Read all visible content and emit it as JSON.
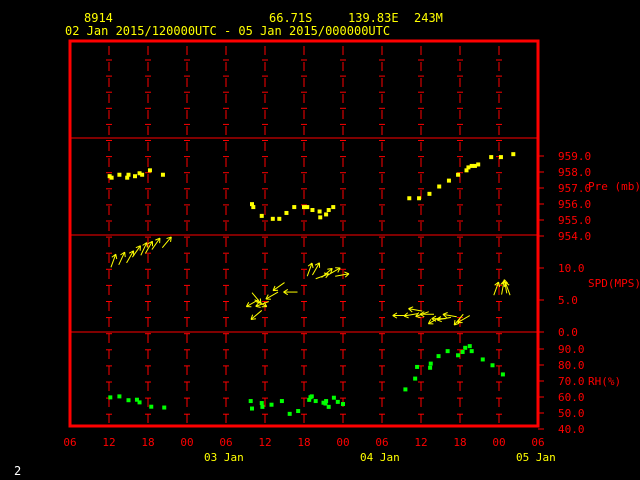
{
  "header": {
    "station_id": "8914",
    "latitude": "66.71S",
    "longitude": "139.83E",
    "elevation": "243M",
    "time_range": "02 Jan 2015/120000UTC - 05 Jan 2015/000000UTC"
  },
  "page_number": "2",
  "colors": {
    "frame": "#ff0000",
    "header_text": "#ffff00",
    "axis_text": "#ff0000",
    "time_text": "#ffff00",
    "pressure_series": "#ffff00",
    "wind_series": "#ffff00",
    "rh_series": "#00ff00"
  },
  "chart_data": {
    "type": "scatter",
    "x_axis": {
      "unit": "hours since 02 Jan 2015 00 UTC",
      "range": [
        6,
        78
      ],
      "tick_labels": [
        "06",
        "12",
        "18",
        "00",
        "06",
        "12",
        "18",
        "00",
        "06",
        "12",
        "18",
        "00",
        "06"
      ],
      "day_labels": [
        {
          "label": "03 Jan",
          "hour": 30
        },
        {
          "label": "04 Jan",
          "hour": 54
        },
        {
          "label": "05 Jan",
          "hour": 78
        }
      ]
    },
    "panels": [
      {
        "name": "pressure",
        "axis_label": "Pre (mb)",
        "ylim": [
          953.6,
          960.2
        ],
        "ticks": [
          "959.0",
          "958.0",
          "957.0",
          "956.0",
          "955.0",
          "954.0"
        ],
        "marker": "square",
        "points": [
          [
            12.1,
            957.6
          ],
          [
            12.4,
            957.5
          ],
          [
            13.6,
            957.7
          ],
          [
            14.8,
            957.5
          ],
          [
            15.0,
            957.7
          ],
          [
            16.0,
            957.6
          ],
          [
            16.7,
            957.8
          ],
          [
            17.1,
            957.7
          ],
          [
            18.3,
            958.0
          ],
          [
            20.3,
            957.7
          ],
          [
            34.0,
            955.7
          ],
          [
            34.2,
            955.5
          ],
          [
            35.5,
            954.9
          ],
          [
            37.2,
            954.7
          ],
          [
            38.2,
            954.7
          ],
          [
            39.3,
            955.1
          ],
          [
            40.5,
            955.5
          ],
          [
            42.0,
            955.5
          ],
          [
            42.5,
            955.5
          ],
          [
            43.3,
            955.3
          ],
          [
            44.4,
            955.2
          ],
          [
            44.5,
            954.8
          ],
          [
            45.4,
            955.0
          ],
          [
            45.8,
            955.3
          ],
          [
            46.5,
            955.5
          ],
          [
            58.2,
            956.1
          ],
          [
            59.7,
            956.1
          ],
          [
            61.3,
            956.4
          ],
          [
            62.8,
            956.9
          ],
          [
            64.3,
            957.3
          ],
          [
            65.7,
            957.7
          ],
          [
            67.0,
            958.0
          ],
          [
            67.3,
            958.2
          ],
          [
            67.8,
            958.3
          ],
          [
            68.3,
            958.3
          ],
          [
            68.8,
            958.4
          ],
          [
            70.8,
            958.9
          ],
          [
            72.3,
            958.9
          ],
          [
            74.2,
            959.1
          ]
        ]
      },
      {
        "name": "wind",
        "axis_label": "SPD(MPS)",
        "ylim": [
          -0.8,
          14.5
        ],
        "ticks": [
          "10.0",
          "5.0",
          "0.0"
        ],
        "note": "arrows drawn at speed height; direction is the meteorological 'from' direction in degrees",
        "points": [
          {
            "h": 12.3,
            "spd": 9.4,
            "dir": 200
          },
          {
            "h": 13.5,
            "spd": 9.8,
            "dir": 205
          },
          {
            "h": 14.7,
            "spd": 10.1,
            "dir": 210
          },
          {
            "h": 15.6,
            "spd": 11.0,
            "dir": 215
          },
          {
            "h": 16.9,
            "spd": 11.3,
            "dir": 205
          },
          {
            "h": 17.6,
            "spd": 11.6,
            "dir": 210
          },
          {
            "h": 18.6,
            "spd": 12.2,
            "dir": 215
          },
          {
            "h": 20.2,
            "spd": 12.5,
            "dir": 220
          },
          {
            "h": 34.0,
            "spd": 5.4,
            "dir": 320
          },
          {
            "h": 34.4,
            "spd": 4.3,
            "dir": 300
          },
          {
            "h": 35.0,
            "spd": 4.3,
            "dir": 60
          },
          {
            "h": 35.5,
            "spd": 2.6,
            "dir": 50
          },
          {
            "h": 36.6,
            "spd": 4.0,
            "dir": 70
          },
          {
            "h": 38.0,
            "spd": 5.5,
            "dir": 60
          },
          {
            "h": 39.0,
            "spd": 7.0,
            "dir": 55
          },
          {
            "h": 41.0,
            "spd": 5.5,
            "dir": 90
          },
          {
            "h": 42.5,
            "spd": 8.0,
            "dir": 200
          },
          {
            "h": 43.3,
            "spd": 8.2,
            "dir": 210
          },
          {
            "h": 43.8,
            "spd": 7.6,
            "dir": 250
          },
          {
            "h": 44.7,
            "spd": 7.8,
            "dir": 230
          },
          {
            "h": 45.7,
            "spd": 8.2,
            "dir": 240
          },
          {
            "h": 46.8,
            "spd": 8.0,
            "dir": 260
          },
          {
            "h": 57.8,
            "spd": 1.8,
            "dir": 90
          },
          {
            "h": 59.5,
            "spd": 2.1,
            "dir": 80
          },
          {
            "h": 60.2,
            "spd": 2.5,
            "dir": 100
          },
          {
            "h": 61.2,
            "spd": 2.4,
            "dir": 70
          },
          {
            "h": 62.0,
            "spd": 2.0,
            "dir": 90
          },
          {
            "h": 63.0,
            "spd": 1.6,
            "dir": 60
          },
          {
            "h": 63.8,
            "spd": 1.3,
            "dir": 90
          },
          {
            "h": 64.6,
            "spd": 1.5,
            "dir": 80
          },
          {
            "h": 65.5,
            "spd": 1.6,
            "dir": 100
          },
          {
            "h": 66.5,
            "spd": 2.0,
            "dir": 40
          },
          {
            "h": 67.5,
            "spd": 1.8,
            "dir": 60
          },
          {
            "h": 71.2,
            "spd": 5.0,
            "dir": 200
          },
          {
            "h": 72.4,
            "spd": 5.1,
            "dir": 190
          },
          {
            "h": 73.2,
            "spd": 5.3,
            "dir": 170
          },
          {
            "h": 73.7,
            "spd": 5.0,
            "dir": 160
          }
        ]
      },
      {
        "name": "rh",
        "axis_label": "RH(%)",
        "ylim": [
          40.0,
          96.5
        ],
        "ticks": [
          "90.0",
          "80.0",
          "70.0",
          "60.0",
          "50.0",
          "40.0"
        ],
        "marker": "square",
        "points": [
          [
            12.2,
            57.2
          ],
          [
            13.6,
            57.8
          ],
          [
            15.0,
            55.5
          ],
          [
            16.3,
            55.8
          ],
          [
            16.7,
            54.2
          ],
          [
            18.5,
            51.6
          ],
          [
            20.5,
            51.1
          ],
          [
            33.8,
            55.0
          ],
          [
            34.0,
            50.5
          ],
          [
            35.5,
            53.8
          ],
          [
            35.6,
            51.5
          ],
          [
            37.0,
            52.8
          ],
          [
            38.6,
            55.0
          ],
          [
            39.8,
            47.3
          ],
          [
            41.1,
            49.0
          ],
          [
            42.8,
            55.7
          ],
          [
            43.0,
            57.3
          ],
          [
            43.2,
            57.8
          ],
          [
            43.8,
            55.0
          ],
          [
            45.0,
            54.0
          ],
          [
            45.4,
            55.0
          ],
          [
            45.3,
            53.5
          ],
          [
            45.8,
            51.5
          ],
          [
            46.6,
            57.0
          ],
          [
            47.2,
            54.5
          ],
          [
            48.0,
            53.2
          ],
          [
            57.6,
            62.0
          ],
          [
            59.1,
            68.5
          ],
          [
            59.4,
            75.5
          ],
          [
            61.4,
            75.0
          ],
          [
            61.5,
            77.5
          ],
          [
            62.7,
            82.0
          ],
          [
            64.1,
            85.0
          ],
          [
            65.7,
            82.5
          ],
          [
            66.4,
            84.5
          ],
          [
            66.8,
            87.0
          ],
          [
            67.5,
            88.0
          ],
          [
            67.8,
            85.0
          ],
          [
            69.5,
            80.0
          ],
          [
            71.0,
            76.5
          ],
          [
            72.6,
            71.0
          ]
        ]
      }
    ]
  }
}
